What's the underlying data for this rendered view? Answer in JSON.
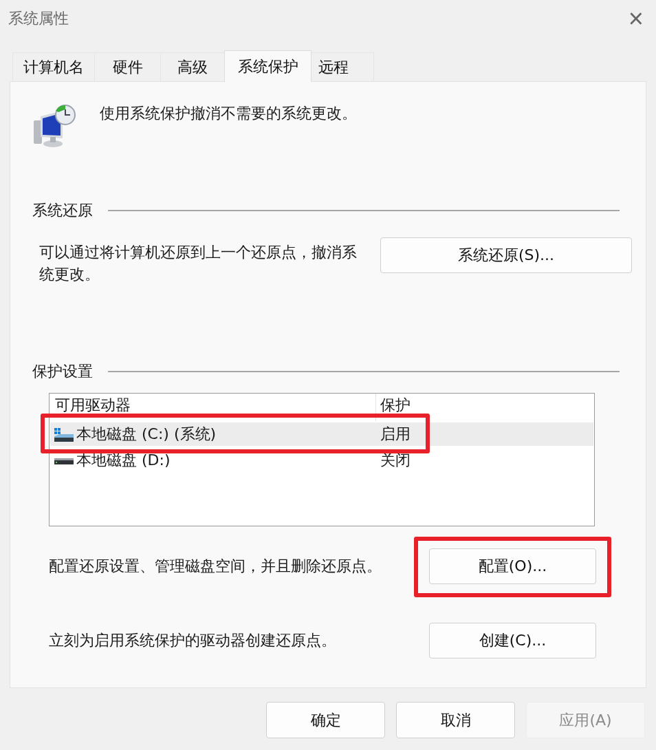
{
  "window": {
    "title": "系统属性",
    "close": "×"
  },
  "tabs": [
    {
      "label": "计算机名",
      "selected": false
    },
    {
      "label": "硬件",
      "selected": false
    },
    {
      "label": "高级",
      "selected": false
    },
    {
      "label": "系统保护",
      "selected": true
    },
    {
      "label": "远程",
      "selected": false
    }
  ],
  "intro": "使用系统保护撤消不需要的系统更改。",
  "restore_group": {
    "title": "系统还原",
    "text": "可以通过将计算机还原到上一个还原点，撤消系统更改。",
    "button": "系统还原(S)..."
  },
  "protection_group": {
    "title": "保护设置",
    "columns": [
      "可用驱动器",
      "保护"
    ],
    "drives": [
      {
        "name": "本地磁盘 (C:) (系统)",
        "protection": "启用",
        "system": true,
        "selected": true,
        "highlighted": true
      },
      {
        "name": "本地磁盘 (D:)",
        "protection": "关闭",
        "system": false,
        "selected": false,
        "highlighted": false
      }
    ],
    "actions": [
      {
        "text": "配置还原设置、管理磁盘空间，并且删除还原点。",
        "button": "配置(O)...",
        "highlighted": true
      },
      {
        "text": "立刻为启用系统保护的驱动器创建还原点。",
        "button": "创建(C)...",
        "highlighted": false
      }
    ]
  },
  "buttons": [
    {
      "label": "确定",
      "disabled": false
    },
    {
      "label": "取消",
      "disabled": false
    },
    {
      "label": "应用(A)",
      "disabled": true
    }
  ]
}
